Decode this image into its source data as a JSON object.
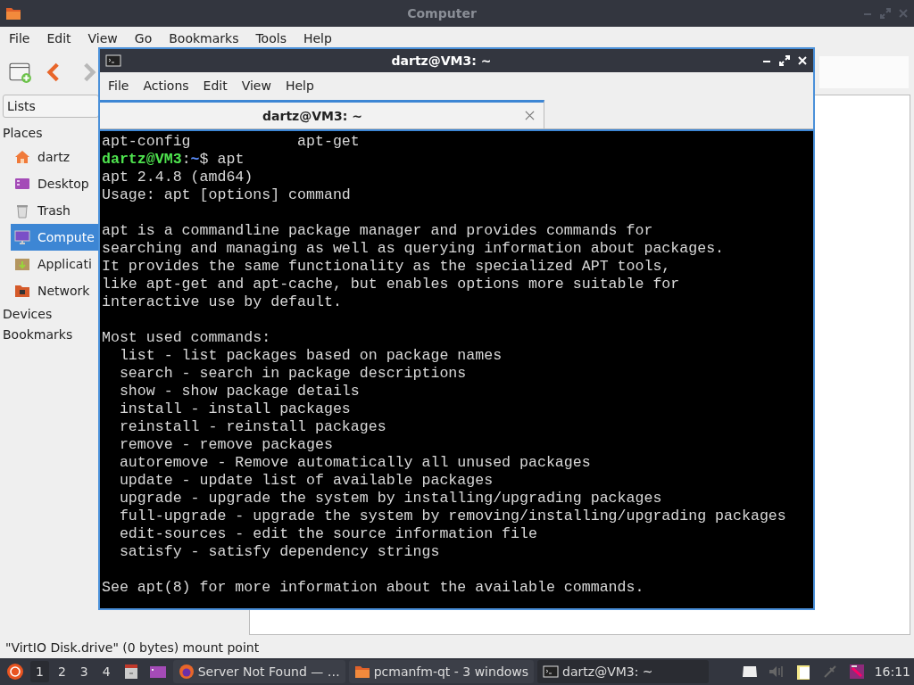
{
  "file_manager": {
    "title": "Computer",
    "menu": [
      "File",
      "Edit",
      "View",
      "Go",
      "Bookmarks",
      "Tools",
      "Help"
    ],
    "side_pane_selector": "Lists",
    "sections": [
      {
        "label": "Places",
        "items": [
          {
            "label": "dartz",
            "kind": "home",
            "selected": false
          },
          {
            "label": "Desktop",
            "kind": "desktop",
            "selected": false
          },
          {
            "label": "Trash",
            "kind": "trash",
            "selected": false
          },
          {
            "label": "Compute",
            "kind": "computer",
            "selected": true
          },
          {
            "label": "Applicati",
            "kind": "applications",
            "selected": false
          },
          {
            "label": "Network",
            "kind": "network",
            "selected": false
          }
        ]
      },
      {
        "label": "Devices"
      },
      {
        "label": "Bookmarks"
      }
    ],
    "status_bar": "\"VirtIO Disk.drive\" (0 bytes) mount point"
  },
  "terminal": {
    "title": "dartz@VM3: ~",
    "menu": [
      "File",
      "Actions",
      "Edit",
      "View",
      "Help"
    ],
    "tabs": [
      {
        "label": "dartz@VM3: ~",
        "selected": true
      }
    ],
    "lines": [
      {
        "kind": "text",
        "text": "apt-config            apt-get"
      },
      {
        "kind": "prompt",
        "user": "dartz@VM3",
        "separator": ":",
        "path": "~",
        "symbol": "$",
        "command": "apt"
      },
      {
        "kind": "text",
        "text": "apt 2.4.8 (amd64)"
      },
      {
        "kind": "text",
        "text": "Usage: apt [options] command"
      },
      {
        "kind": "blank"
      },
      {
        "kind": "text",
        "text": "apt is a commandline package manager and provides commands for"
      },
      {
        "kind": "text",
        "text": "searching and managing as well as querying information about packages."
      },
      {
        "kind": "text",
        "text": "It provides the same functionality as the specialized APT tools,"
      },
      {
        "kind": "text",
        "text": "like apt-get and apt-cache, but enables options more suitable for"
      },
      {
        "kind": "text",
        "text": "interactive use by default."
      },
      {
        "kind": "blank"
      },
      {
        "kind": "text",
        "text": "Most used commands:"
      },
      {
        "kind": "text",
        "text": "  list - list packages based on package names"
      },
      {
        "kind": "text",
        "text": "  search - search in package descriptions"
      },
      {
        "kind": "text",
        "text": "  show - show package details"
      },
      {
        "kind": "text",
        "text": "  install - install packages"
      },
      {
        "kind": "text",
        "text": "  reinstall - reinstall packages"
      },
      {
        "kind": "text",
        "text": "  remove - remove packages"
      },
      {
        "kind": "text",
        "text": "  autoremove - Remove automatically all unused packages"
      },
      {
        "kind": "text",
        "text": "  update - update list of available packages"
      },
      {
        "kind": "text",
        "text": "  upgrade - upgrade the system by installing/upgrading packages"
      },
      {
        "kind": "text",
        "text": "  full-upgrade - upgrade the system by removing/installing/upgrading packages"
      },
      {
        "kind": "text",
        "text": "  edit-sources - edit the source information file"
      },
      {
        "kind": "text",
        "text": "  satisfy - satisfy dependency strings"
      },
      {
        "kind": "blank"
      },
      {
        "kind": "text",
        "text": "See apt(8) for more information about the available commands."
      }
    ]
  },
  "taskbar": {
    "desktops": [
      {
        "label": "1",
        "selected": true
      },
      {
        "label": "2",
        "selected": false
      },
      {
        "label": "3",
        "selected": false
      },
      {
        "label": "4",
        "selected": false
      }
    ],
    "tasks": [
      {
        "label": "Server Not Found — …",
        "kind": "browser",
        "selected": false
      },
      {
        "label": "pcmanfm-qt - 3 windows",
        "kind": "folder",
        "selected": false
      },
      {
        "label": "dartz@VM3: ~",
        "kind": "terminal",
        "selected": true
      }
    ],
    "clock": "16:11"
  }
}
